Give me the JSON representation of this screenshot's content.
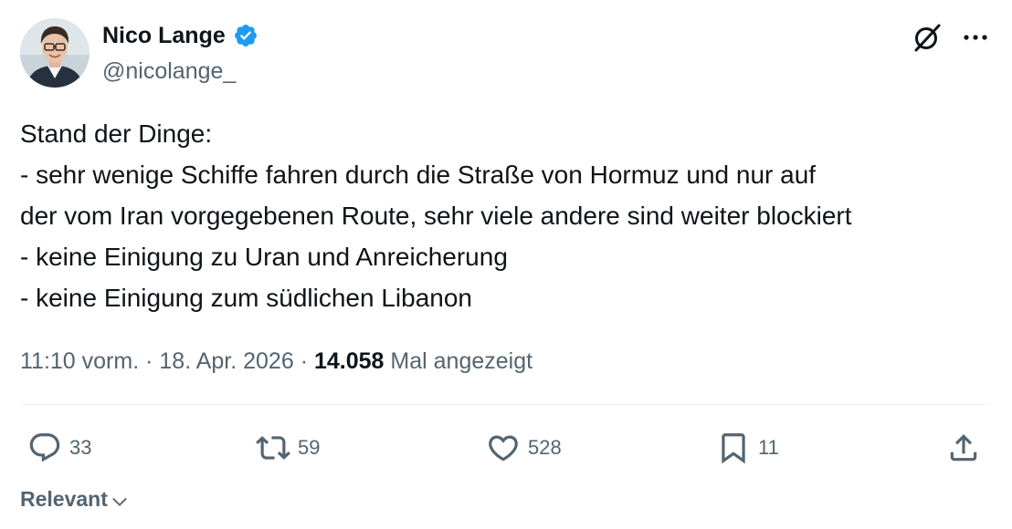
{
  "author": {
    "name": "Nico Lange",
    "handle": "@nicolange_",
    "verified": true,
    "verified_color": "#1d9bf0"
  },
  "tweet": {
    "lines": [
      "Stand der Dinge:",
      "- sehr wenige Schiffe fahren durch die Straße von Hormuz und nur auf",
      "der vom Iran vorgegebenen Route, sehr viele andere sind weiter blockiert",
      "- keine Einigung zu Uran und Anreicherung",
      "- keine Einigung zum südlichen Libanon"
    ]
  },
  "meta": {
    "time": "11:10 vorm.",
    "separator": "·",
    "date": "18. Apr. 2026",
    "views": "14.058",
    "views_label": "Mal angezeigt"
  },
  "actions": {
    "replies": "33",
    "reposts": "59",
    "likes": "528",
    "bookmarks": "11"
  },
  "sort": {
    "label": "Relevant"
  },
  "icons": {
    "grok": "grok-icon",
    "more": "more-icon",
    "reply": "reply-icon",
    "repost": "repost-icon",
    "like": "like-icon",
    "bookmark": "bookmark-icon",
    "share": "share-icon"
  },
  "colors": {
    "text": "#0f1419",
    "secondary": "#536471",
    "divider": "#eff3f4"
  }
}
